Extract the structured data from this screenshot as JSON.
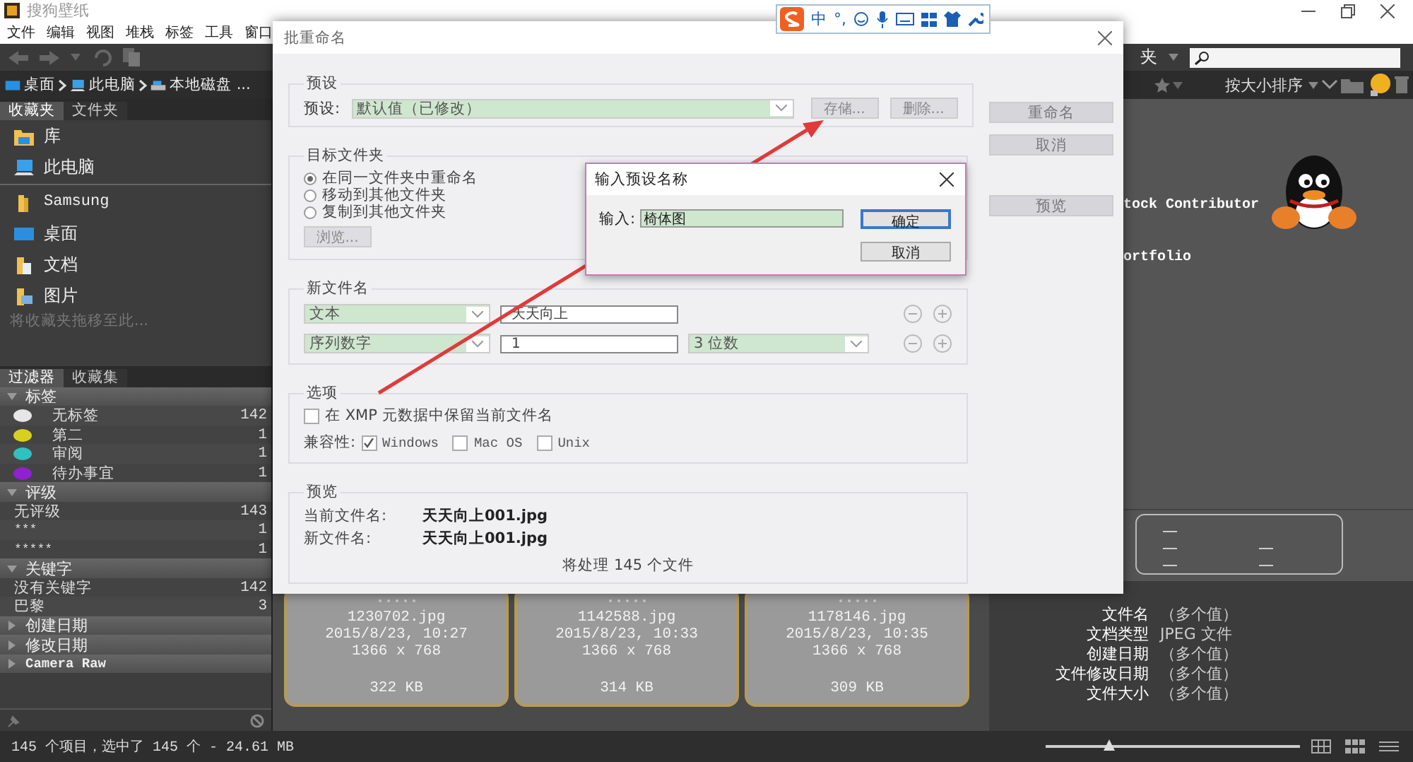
{
  "app": {
    "title": "搜狗壁纸",
    "menu": [
      "文件",
      "编辑",
      "视图",
      "堆栈",
      "标签",
      "工具",
      "窗口"
    ],
    "path_cut": "夹",
    "breadcrumb": [
      {
        "label": "桌面",
        "kind": "desktop"
      },
      {
        "label": "此电脑",
        "kind": "computer"
      },
      {
        "label": "本地磁盘 ...",
        "kind": "drive"
      }
    ],
    "sort": "按大小排序",
    "left_tabs": [
      {
        "label": "收藏夹",
        "selected": true
      },
      {
        "label": "文件夹",
        "selected": false
      }
    ],
    "favorites": [
      {
        "label": "库",
        "kind": "library"
      },
      {
        "label": "此电脑",
        "kind": "computer"
      }
    ],
    "folders": [
      {
        "label": "Samsung",
        "kind": "folder"
      },
      {
        "label": "桌面",
        "kind": "desktop"
      },
      {
        "label": "文档",
        "kind": "documents"
      },
      {
        "label": "图片",
        "kind": "pictures"
      }
    ],
    "favorites_hint": "将收藏夹拖移至此...",
    "filter_tabs": [
      {
        "label": "过滤器",
        "selected": true
      },
      {
        "label": "收藏集",
        "selected": false
      }
    ],
    "filters": [
      {
        "title": "标签",
        "expanded": true,
        "items": [
          {
            "label": "无标签",
            "count": "142",
            "color": "#e6e6e6"
          },
          {
            "label": "第二",
            "count": "1",
            "color": "#d8d020"
          },
          {
            "label": "审阅",
            "count": "1",
            "color": "#30c0c0"
          },
          {
            "label": "待办事宜",
            "count": "1",
            "color": "#9020d0"
          }
        ]
      },
      {
        "title": "评级",
        "expanded": true,
        "items": [
          {
            "label": "无评级",
            "count": "143"
          },
          {
            "label": "***",
            "count": "1"
          },
          {
            "label": "*****",
            "count": "1"
          }
        ]
      },
      {
        "title": "关键字",
        "expanded": true,
        "items": [
          {
            "label": "没有关键字",
            "count": "142"
          },
          {
            "label": "巴黎",
            "count": "3"
          }
        ]
      },
      {
        "title": "创建日期",
        "expanded": false
      },
      {
        "title": "修改日期",
        "expanded": false
      },
      {
        "title": "Camera Raw",
        "expanded": false
      }
    ],
    "content_texts": [
      "tock Contributor",
      "ortfolio"
    ],
    "thumbnails": [
      {
        "name": "1230702.jpg",
        "date": "2015/8/23, 10:27",
        "dimensions": "1366 x 768",
        "size": "322 KB"
      },
      {
        "name": "1142588.jpg",
        "date": "2015/8/23, 10:33",
        "dimensions": "1366 x 768",
        "size": "314 KB"
      },
      {
        "name": "1178146.jpg",
        "date": "2015/8/23, 10:35",
        "dimensions": "1366 x 768",
        "size": "309 KB"
      }
    ],
    "file_properties": [
      {
        "label": "文件名",
        "value": "（多个值）"
      },
      {
        "label": "文档类型",
        "value": "JPEG 文件"
      },
      {
        "label": "创建日期",
        "value": "（多个值）"
      },
      {
        "label": "文件修改日期",
        "value": "（多个值）"
      },
      {
        "label": "文件大小",
        "value": "（多个值）"
      }
    ],
    "status": "145 个项目，选中了 145 个 - 24.61 MB",
    "thumbnail_slider": {
      "level": 0.25
    }
  },
  "rename_dialog": {
    "title": "批重命名",
    "buttons": [
      {
        "label": "重命名"
      },
      {
        "label": "取消"
      },
      {
        "label": "预览"
      }
    ],
    "preset": {
      "heading": "预设",
      "label": "预设:",
      "value": "默认值（已修改）",
      "buttons": [
        {
          "label": "存储..."
        },
        {
          "label": "删除..."
        }
      ]
    },
    "target_folder": {
      "heading": "目标文件夹",
      "options": [
        {
          "label": "在同一文件夹中重命名",
          "selected": true
        },
        {
          "label": "移动到其他文件夹",
          "selected": false
        },
        {
          "label": "复制到其他文件夹",
          "selected": false
        }
      ],
      "browse": "浏览..."
    },
    "new_filename": {
      "heading": "新文件名",
      "rows": [
        {
          "type": "文本",
          "value": "天天向上"
        },
        {
          "type": "序列数字",
          "value": "1",
          "digits": "3 位数"
        }
      ]
    },
    "options": {
      "heading": "选项",
      "keep_xmp": {
        "label": "在 XMP 元数据中保留当前文件名",
        "checked": false
      },
      "compat_label": "兼容性:",
      "compat": [
        {
          "label": "Windows",
          "checked": true
        },
        {
          "label": "Mac OS",
          "checked": false
        },
        {
          "label": "Unix",
          "checked": false
        }
      ]
    },
    "preview": {
      "heading": "预览",
      "current_label": "当前文件名:",
      "current": "天天向上001.jpg",
      "new_label": "新文件名:",
      "new": "天天向上001.jpg",
      "summary": "将处理 145 个文件"
    }
  },
  "preset_dialog": {
    "title": "输入预设名称",
    "label": "输入:",
    "value": "椅体图",
    "buttons": [
      {
        "label": "确定",
        "default": true
      },
      {
        "label": "取消",
        "default": false
      }
    ]
  },
  "ime_bar": {
    "mode": "中",
    "punctuation": "°,"
  }
}
